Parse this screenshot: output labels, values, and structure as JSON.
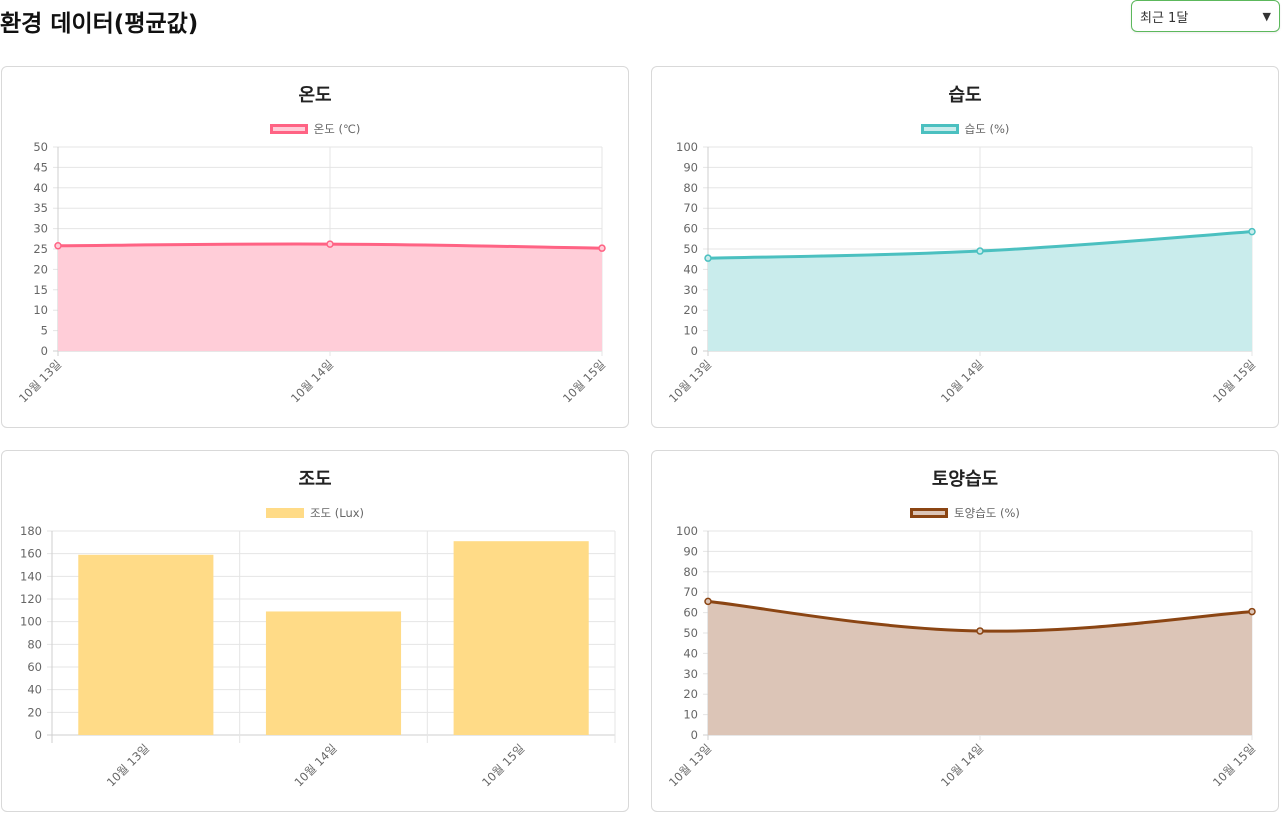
{
  "header": {
    "title": "환경 데이터(평균값)",
    "range_select": {
      "selected": "최근 1달"
    }
  },
  "colors": {
    "temperature": "#ff6384",
    "humidity": "#4bc0c0",
    "illuminance": "#ffcd56",
    "soil": "#8b4513"
  },
  "chart_data": [
    {
      "type": "line",
      "title": "온도",
      "categories": [
        "10월 13일",
        "10월 14일",
        "10월 15일"
      ],
      "series": [
        {
          "name": "온도 (℃)",
          "values": [
            25.8,
            26.2,
            25.2
          ]
        }
      ],
      "ylim": [
        0,
        50
      ],
      "ystep": 5,
      "fill": true,
      "grid": true,
      "legend": "top",
      "line_color": "#ff6384",
      "fill_color": "#ffcdd8"
    },
    {
      "type": "line",
      "title": "습도",
      "categories": [
        "10월 13일",
        "10월 14일",
        "10월 15일"
      ],
      "series": [
        {
          "name": "습도 (%)",
          "values": [
            45.5,
            49,
            58.5
          ]
        }
      ],
      "ylim": [
        0,
        100
      ],
      "ystep": 10,
      "fill": true,
      "grid": true,
      "legend": "top",
      "line_color": "#4bc0c0",
      "fill_color": "#c9ecec"
    },
    {
      "type": "bar",
      "title": "조도",
      "categories": [
        "10월 13일",
        "10월 14일",
        "10월 15일"
      ],
      "series": [
        {
          "name": "조도 (Lux)",
          "values": [
            159,
            109,
            171
          ]
        }
      ],
      "ylim": [
        0,
        180
      ],
      "ystep": 20,
      "grid": true,
      "legend": "top",
      "line_color": "#ffdb87",
      "fill_color": "#ffdb87"
    },
    {
      "type": "line",
      "title": "토양습도",
      "categories": [
        "10월 13일",
        "10월 14일",
        "10월 15일"
      ],
      "series": [
        {
          "name": "토양습도 (%)",
          "values": [
            65.5,
            51,
            60.5
          ]
        }
      ],
      "ylim": [
        0,
        100
      ],
      "ystep": 10,
      "fill": true,
      "grid": true,
      "legend": "top",
      "line_color": "#8b4513",
      "fill_color": "#dcc5b7"
    }
  ]
}
